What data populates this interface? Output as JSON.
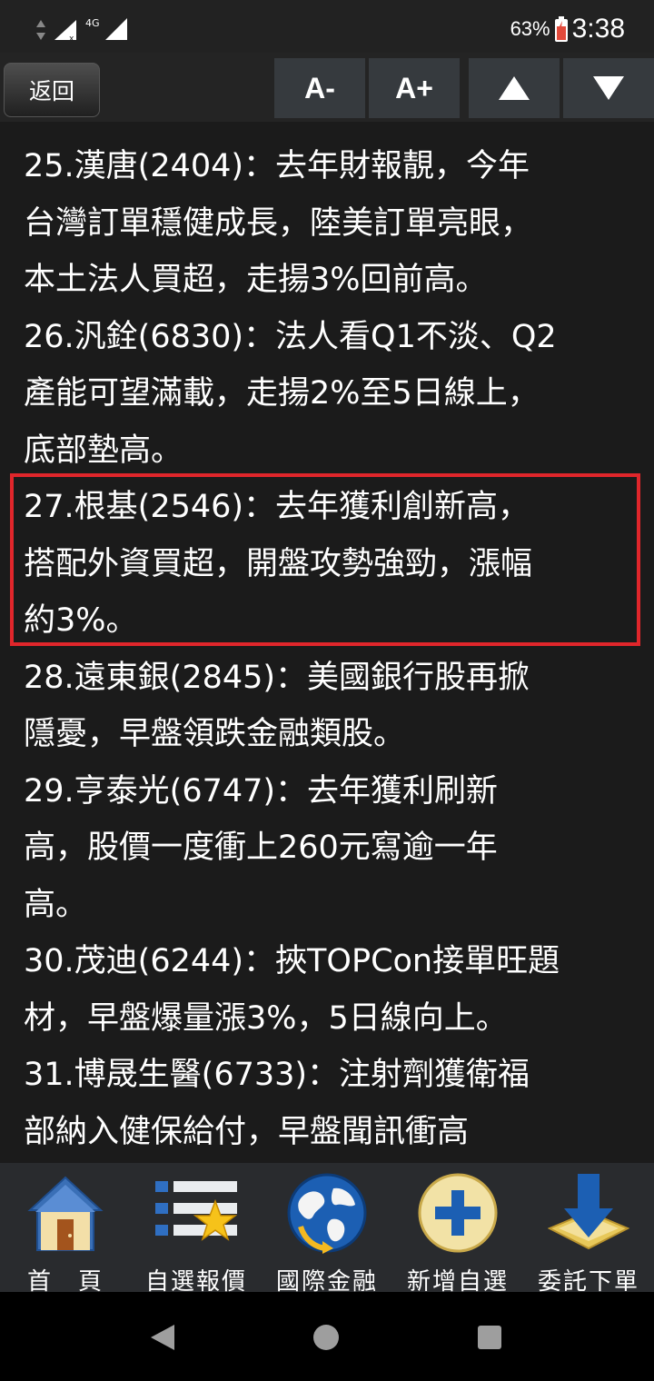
{
  "status_bar": {
    "network": "4G",
    "battery": "63%",
    "time": "3:38"
  },
  "toolbar": {
    "back_label": "返回",
    "font_decrease_label": "A-",
    "font_increase_label": "A+",
    "scroll_up_icon": "triangle-up-icon",
    "scroll_down_icon": "triangle-down-icon"
  },
  "articles": [
    {
      "lines": [
        "25.漢唐(2404)：去年財報靚，今年",
        "台灣訂單穩健成長，陸美訂單亮眼，",
        "本土法人買超，走揚3%回前高。"
      ]
    },
    {
      "lines": [
        "26.汎銓(6830)：法人看Q1不淡、Q2",
        "產能可望滿載，走揚2%至5日線上，",
        "底部墊高。"
      ]
    },
    {
      "lines": [
        "27.根基(2546)：去年獲利創新高，",
        "搭配外資買超，開盤攻勢強勁，漲幅",
        "約3%。"
      ],
      "highlighted": true
    },
    {
      "lines": [
        "28.遠東銀(2845)：美國銀行股再掀",
        "隱憂，早盤領跌金融類股。"
      ]
    },
    {
      "lines": [
        "29.亨泰光(6747)：去年獲利刷新",
        "高，股價一度衝上260元寫逾一年",
        "高。"
      ]
    },
    {
      "lines": [
        "30.茂迪(6244)：挾TOPCon接單旺題",
        "材，早盤爆量漲3%，5日線向上。"
      ]
    },
    {
      "lines": [
        "31.博晟生醫(6733)：注射劑獲衛福",
        "部納入健保給付，早盤聞訊衝高"
      ]
    }
  ],
  "bottom_nav": [
    {
      "label": "首　頁",
      "icon": "home-icon"
    },
    {
      "label": "自選報價",
      "icon": "watchlist-star-icon"
    },
    {
      "label": "國際金融",
      "icon": "globe-icon"
    },
    {
      "label": "新增自選",
      "icon": "add-plus-icon"
    },
    {
      "label": "委託下單",
      "icon": "order-download-icon"
    }
  ],
  "colors": {
    "background": "#1b1b1b",
    "highlight_border": "#e0262b",
    "toolbar_button": "#363a3e"
  }
}
